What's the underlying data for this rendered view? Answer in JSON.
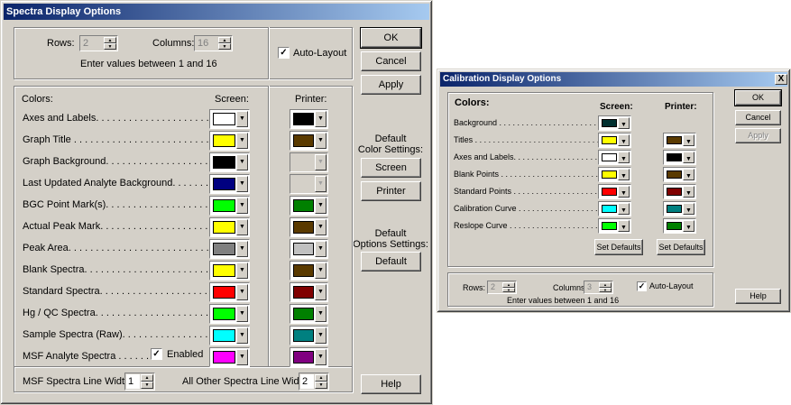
{
  "main": {
    "title": "Spectra Display Options",
    "rows_label": "Rows:",
    "rows_value": "2",
    "columns_label": "Columns:",
    "columns_value": "16",
    "auto_layout_label": "Auto-Layout",
    "hint": "Enter values between 1 and 16",
    "ok": "OK",
    "cancel": "Cancel",
    "apply": "Apply",
    "colors_header": "Colors:",
    "screen_header": "Screen:",
    "printer_header": "Printer:",
    "default_color_settings": [
      "Default",
      "Color Settings:"
    ],
    "screen_button": "Screen",
    "printer_button": "Printer",
    "default_options_settings": [
      "Default",
      "Options Settings:"
    ],
    "default_button": "Default",
    "enabled_label": "Enabled",
    "msf_line_width_label": "MSF Spectra Line Width:",
    "msf_line_width_value": "1",
    "other_line_width_label": "All Other Spectra Line Width:",
    "other_line_width_value": "2",
    "help": "Help",
    "rows": [
      {
        "label": "Axes and Labels. . . . . . . . . . . . . . . . . . . . . .",
        "screen": "#ffffff",
        "printer": "#000000"
      },
      {
        "label": "Graph Title . . . . . . . . . . . . . . . . . . . . . . . . .",
        "screen": "#ffff00",
        "printer": "#5a3a00"
      },
      {
        "label": "Graph Background. . . . . . . . . . . . . . . . . . . .",
        "screen": "#000000",
        "printer": null
      },
      {
        "label": "Last Updated Analyte Background. . . . . . . . .",
        "screen": "#000080",
        "printer": null
      },
      {
        "label": "BGC Point Mark(s). . . . . . . .  . . . . . . . . . . .",
        "screen": "#00ff00",
        "printer": "#008000"
      },
      {
        "label": "Actual Peak Mark. . . . . . . . . . . . . . . . . . . . .",
        "screen": "#ffff00",
        "printer": "#5a3a00"
      },
      {
        "label": "Peak Area. . . . . . . . . . . . . . . . . . . . . . . . . . .",
        "screen": "#808080",
        "printer": "#c0c0c0"
      },
      {
        "label": "Blank Spectra. . . . . . . . . . . . . . . . . . . . . . . .",
        "screen": "#ffff00",
        "printer": "#5a3a00"
      },
      {
        "label": "Standard Spectra. . . . . . . . . . . . . . . . . . . . .",
        "screen": "#ff0000",
        "printer": "#800000"
      },
      {
        "label": "Hg / QC Spectra. . . . . . . . . . . . . . . . . . . . . .",
        "screen": "#00ff00",
        "printer": "#008000"
      },
      {
        "label": "Sample Spectra (Raw). . . . . . . . . . . . . . . . .",
        "screen": "#00ffff",
        "printer": "#008080"
      },
      {
        "label": "MSF Analyte Spectra . . . . . . . .",
        "screen": "#ff00ff",
        "printer": "#800080"
      }
    ]
  },
  "calib": {
    "title": "Calibration Display Options",
    "close": "X",
    "colors_header": "Colors:",
    "screen_header": "Screen:",
    "printer_header": "Printer:",
    "ok": "OK",
    "cancel": "Cancel",
    "apply": "Apply",
    "set_defaults_1": "Set Defaults",
    "set_defaults_2": "Set Defaults",
    "rows_label": "Rows:",
    "rows_value": "2",
    "columns_label": "Columns:",
    "columns_value": "3",
    "auto_layout_label": "Auto-Layout",
    "hint": "Enter values between 1 and 16",
    "help": "Help",
    "rows": [
      {
        "label": "Background . . . . . . . . . . . . . . . . . . . . . . . .",
        "screen": "#003030",
        "printer": null
      },
      {
        "label": "Titles . . . . . . . . . . . . . . . . . . . . . . . . . . . . .",
        "screen": "#ffff00",
        "printer": "#5a3a00"
      },
      {
        "label": "Axes and Labels. . . . . . . . . . . . . . . . . . . . . .",
        "screen": "#ffffff",
        "printer": "#000000"
      },
      {
        "label": "Blank Points . . . . . . . . . . . . . . . . . . . . . . . .",
        "screen": "#ffff00",
        "printer": "#5a3a00"
      },
      {
        "label": "Standard Points . . . . . . . . . . . . . . . . . . . . .",
        "screen": "#ff0000",
        "printer": "#800000"
      },
      {
        "label": "Calibration Curve . . . . . . . . . . . . . . . . . . . .",
        "screen": "#00ffff",
        "printer": "#008080"
      },
      {
        "label": "Reslope Curve . . . . . . . . . . . . . . . . . . . . . .",
        "screen": "#00ff00",
        "printer": "#008000"
      }
    ]
  }
}
